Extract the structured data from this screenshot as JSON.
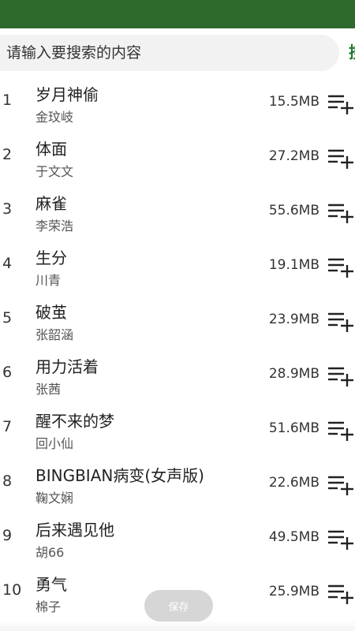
{
  "search": {
    "placeholder": "请输入要搜索的内容",
    "action_label": "搜"
  },
  "songs": [
    {
      "index": "1",
      "title": "岁月神偷",
      "artist": "金玟岐",
      "size": "15.5MB"
    },
    {
      "index": "2",
      "title": "体面",
      "artist": "于文文",
      "size": "27.2MB"
    },
    {
      "index": "3",
      "title": "麻雀",
      "artist": "李荣浩",
      "size": "55.6MB"
    },
    {
      "index": "4",
      "title": "生分",
      "artist": "川青",
      "size": "19.1MB"
    },
    {
      "index": "5",
      "title": "破茧",
      "artist": "张韶涵",
      "size": "23.9MB"
    },
    {
      "index": "6",
      "title": "用力活着",
      "artist": "张茜",
      "size": "28.9MB"
    },
    {
      "index": "7",
      "title": "醒不来的梦",
      "artist": "回小仙",
      "size": "51.6MB"
    },
    {
      "index": "8",
      "title": "BINGBIAN病变(女声版)",
      "artist": "鞠文娴",
      "size": "22.6MB"
    },
    {
      "index": "9",
      "title": "后来遇见他",
      "artist": "胡66",
      "size": "49.5MB"
    },
    {
      "index": "10",
      "title": "勇气",
      "artist": "棉子",
      "size": "25.9MB"
    }
  ],
  "save_button": {
    "label": "保存"
  },
  "colors": {
    "accent": "#1b7a2f",
    "status_bar": "#2e6a2e"
  },
  "icons": {
    "add_to_playlist": "playlist-add-icon"
  }
}
